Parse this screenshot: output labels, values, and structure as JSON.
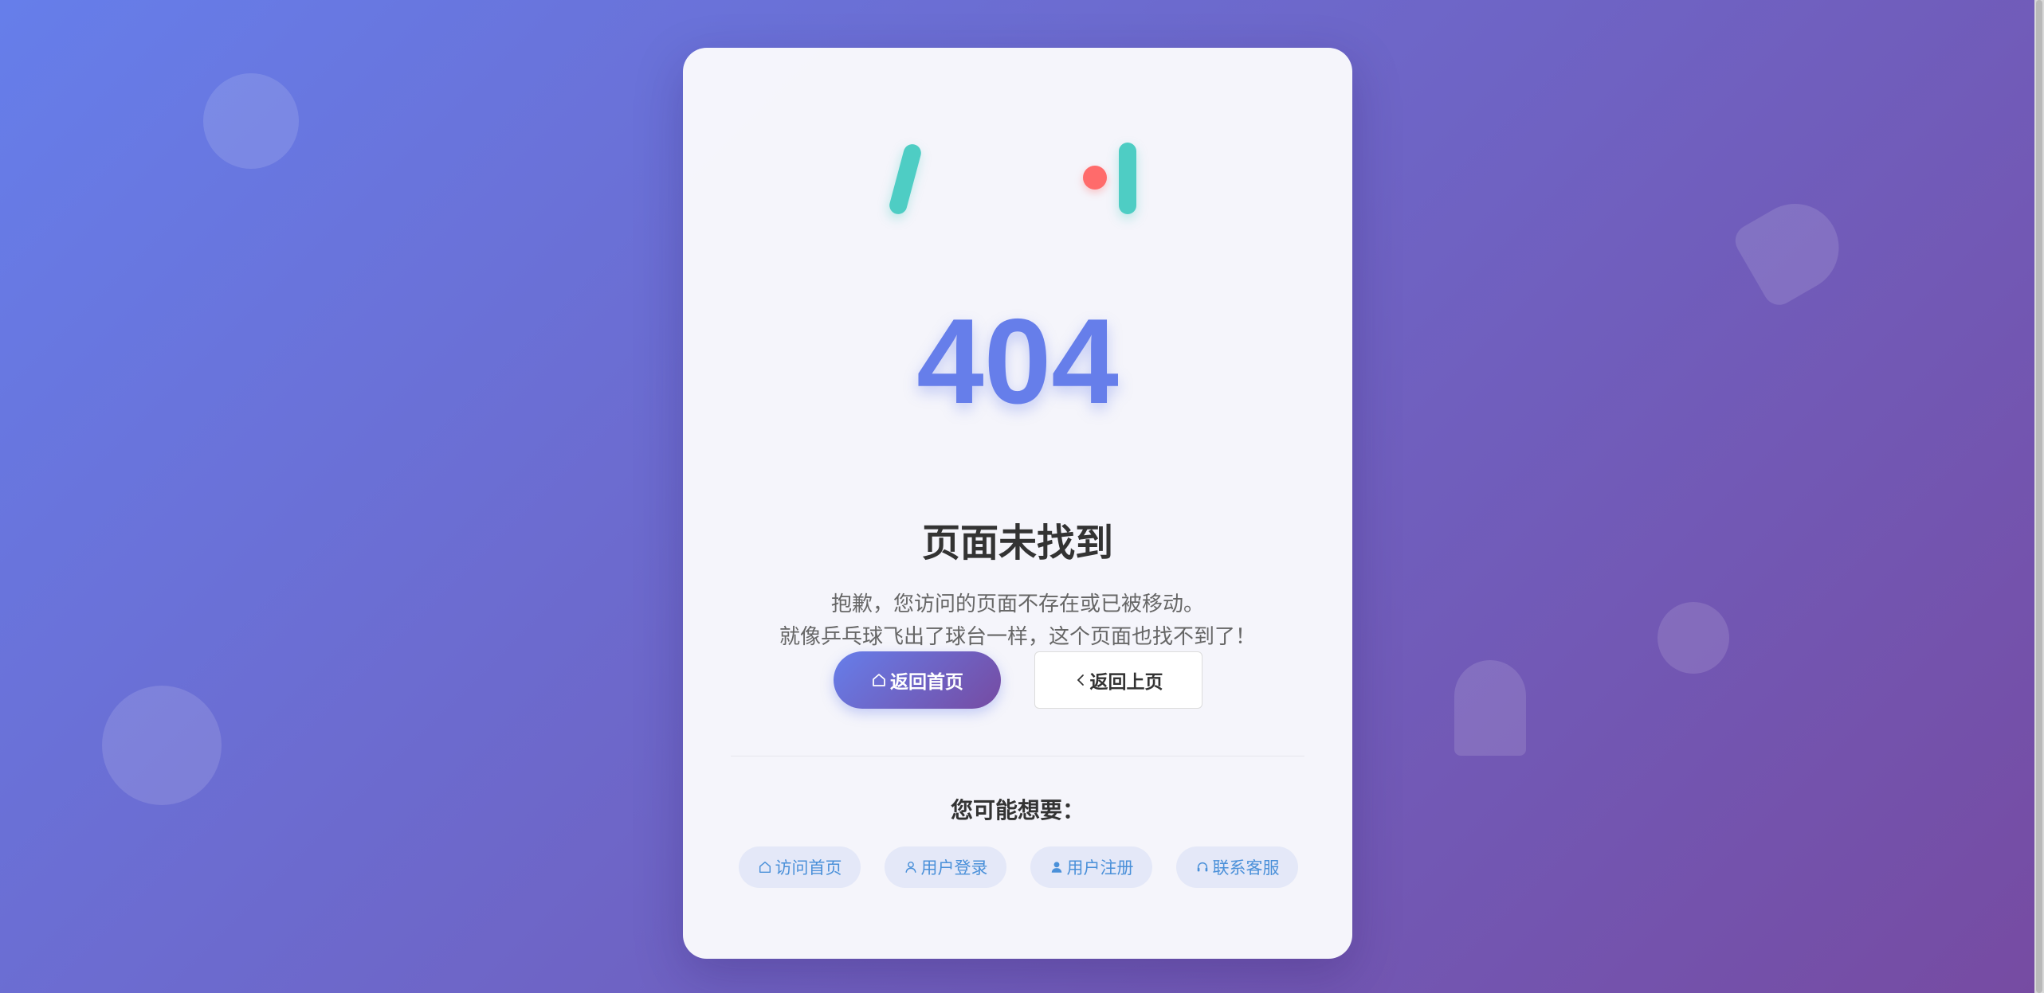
{
  "error": {
    "code": "404",
    "title": "页面未找到",
    "description_line1": "抱歉，您访问的页面不存在或已被移动。",
    "description_line2": "就像乒乓球飞出了球台一样，这个页面也找不到了！"
  },
  "actions": {
    "home_label": "返回首页",
    "back_label": "返回上页"
  },
  "suggestions": {
    "title": "您可能想要：",
    "links": [
      {
        "label": "访问首页",
        "icon": "home-icon"
      },
      {
        "label": "用户登录",
        "icon": "user-icon"
      },
      {
        "label": "用户注册",
        "icon": "user-add-icon"
      },
      {
        "label": "联系客服",
        "icon": "headset-icon"
      }
    ]
  },
  "colors": {
    "background_start": "#667eea",
    "background_end": "#764ba2",
    "code": "#667eea",
    "paddle": "#4ecdc4",
    "ball": "#ff6b6b",
    "chip_text": "#4a90d9"
  }
}
